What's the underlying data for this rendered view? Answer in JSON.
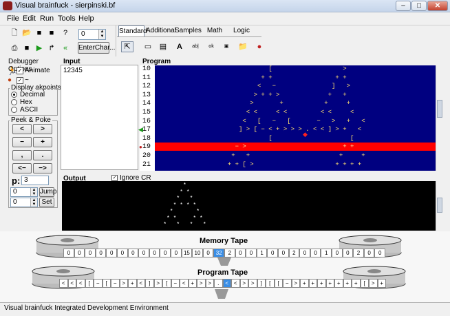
{
  "window": {
    "title": "Visual brainfuck - sierpinski.bf",
    "min": "–",
    "max": "□",
    "close": "✕"
  },
  "menu": [
    "File",
    "Edit",
    "Run",
    "Tools",
    "Help"
  ],
  "toolbar": {
    "spin_value": "0",
    "enter_char_label": "EnterChar..."
  },
  "tabs": [
    "Standard",
    "Additional",
    "Samples",
    "Math",
    "Logic"
  ],
  "palette_icons": [
    "pointer-icon",
    "form-icon",
    "component-icon",
    "text-icon",
    "ab-icon",
    "ok-icon",
    "panel-icon",
    "folder-icon",
    "apple-icon"
  ],
  "debugger": {
    "title": "Debugger Options",
    "animate": "Animate",
    "breakpoints": "~ Breakpoints",
    "display_title": "Display",
    "radios": [
      "Decimal",
      "Hex",
      "ASCII"
    ],
    "peek_title": "Peek & Poke",
    "peek_buttons": [
      "<",
      ">",
      "−",
      "+",
      ",",
      ".",
      "<−",
      "−>"
    ],
    "p_label": "p:",
    "p_value": "3",
    "jump_value": "0",
    "jump_label": "Jump",
    "set_value": "0",
    "set_label": "Set"
  },
  "input": {
    "title": "Input",
    "text": "12345"
  },
  "program": {
    "title": "Program",
    "line_numbers": [
      "10",
      "11",
      "12",
      "13",
      "14",
      "15",
      "16",
      "17",
      "18",
      "19",
      "20",
      "21"
    ],
    "lines": [
      "                  [                   >",
      "                + +                 + +",
      "               <   −               ]   >",
      "              > + + >             +   +",
      "             >       +           +     +",
      "            < <     < <         < <     <",
      "           <   [   −   [       −   >   +   <",
      "          ] > [ − < + > > > . < < ] > +   <",
      "                  [                     [",
      "         − >                          + +",
      "        +   +                        +     +",
      "       + + [ >                      + + + +"
    ]
  },
  "output": {
    "title": "Output",
    "ignore_cr": "Ignore CR",
    "lines": [
      "               *",
      "              * *",
      "             *   *",
      "            * * * *",
      "           *       *",
      "          * *     * *",
      "         *   *   *   *"
    ]
  },
  "memory_tape": {
    "title": "Memory Tape",
    "cells": [
      "0",
      "0",
      "0",
      "0",
      "0",
      "0",
      "0",
      "0",
      "0",
      "0",
      "0",
      "15",
      "10",
      "0",
      "32",
      "2",
      "0",
      "0",
      "1",
      "0",
      "0",
      "2",
      "0",
      "0",
      "1",
      "0",
      "0",
      "2",
      "0",
      "0"
    ],
    "selected": 14
  },
  "program_tape": {
    "title": "Program Tape",
    "cells": [
      "<",
      "<",
      "<",
      "[",
      "−",
      "[",
      "−",
      ">",
      "+",
      "<",
      "]",
      ">",
      "[",
      "−",
      "<",
      "+",
      ">",
      ">",
      ".",
      "<",
      "<",
      ">",
      ">",
      "]",
      "[",
      "[",
      "−",
      ">",
      "+",
      "+",
      "+",
      "+",
      "+",
      "+",
      "+",
      "[",
      ">",
      "+"
    ],
    "selected": 19
  },
  "status": "Visual brainfuck Integrated Development Environment",
  "colors": {
    "program_bg": "#000080",
    "code_text": "#ffe070",
    "highlight": "#ff0000",
    "selected_cell": "#3a8ee6"
  }
}
